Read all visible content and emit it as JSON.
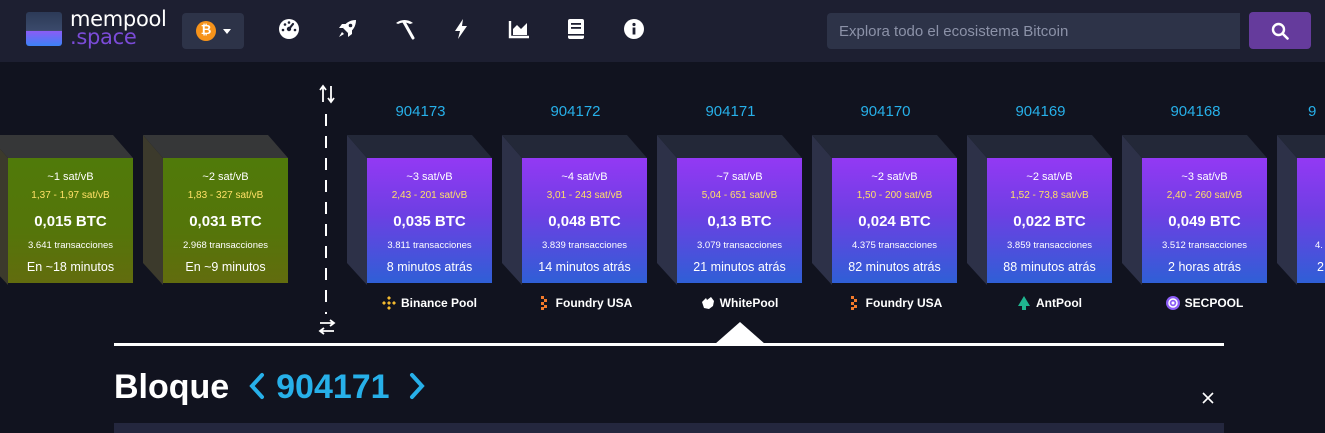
{
  "header": {
    "logo_line1": "mempool",
    "logo_line2": ".space",
    "network_symbol": "₿",
    "search_placeholder": "Explora todo el ecosistema Bitcoin",
    "nav_icons": [
      "dashboard-icon",
      "rocket-icon",
      "mining-icon",
      "lightning-icon",
      "graphs-icon",
      "docs-icon",
      "about-icon"
    ],
    "colors": {
      "bitcoin": "#f7931a",
      "accent": "#653b9c",
      "link": "#27b0e9"
    }
  },
  "pending_blocks": [
    {
      "fee": "~1 sat/vB",
      "range": "1,37 - 1,97 sat/vB",
      "size": "0,015 BTC",
      "tx": "3.641 transacciones",
      "time": "En ~18 minutos"
    },
    {
      "fee": "~2 sat/vB",
      "range": "1,83 - 327 sat/vB",
      "size": "0,031 BTC",
      "tx": "2.968 transacciones",
      "time": "En ~9 minutos"
    }
  ],
  "mined_blocks": [
    {
      "height": "904173",
      "fee": "~3 sat/vB",
      "range": "2,43 - 201 sat/vB",
      "size": "0,035 BTC",
      "tx": "3.811 transacciones",
      "time": "8 minutos atrás",
      "pool": "Binance Pool",
      "pool_icon": "binance-icon"
    },
    {
      "height": "904172",
      "fee": "~4 sat/vB",
      "range": "3,01 - 243 sat/vB",
      "size": "0,048 BTC",
      "tx": "3.839 transacciones",
      "time": "14 minutos atrás",
      "pool": "Foundry USA",
      "pool_icon": "foundry-icon"
    },
    {
      "height": "904171",
      "fee": "~7 sat/vB",
      "range": "5,04 - 651 sat/vB",
      "size": "0,13 BTC",
      "tx": "3.079 transacciones",
      "time": "21 minutos atrás",
      "pool": "WhitePool",
      "pool_icon": "whitepool-icon"
    },
    {
      "height": "904170",
      "fee": "~2 sat/vB",
      "range": "1,50 - 200 sat/vB",
      "size": "0,024 BTC",
      "tx": "4.375 transacciones",
      "time": "82 minutos atrás",
      "pool": "Foundry USA",
      "pool_icon": "foundry-icon"
    },
    {
      "height": "904169",
      "fee": "~2 sat/vB",
      "range": "1,52 - 73,8 sat/vB",
      "size": "0,022 BTC",
      "tx": "3.859 transacciones",
      "time": "88 minutos atrás",
      "pool": "AntPool",
      "pool_icon": "antpool-icon"
    },
    {
      "height": "904168",
      "fee": "~3 sat/vB",
      "range": "2,40 - 260 sat/vB",
      "size": "0,049 BTC",
      "tx": "3.512 transacciones",
      "time": "2 horas atrás",
      "pool": "SECPOOL",
      "pool_icon": "secpool-icon"
    }
  ],
  "partial_block": {
    "height": "9",
    "tx_fragment": "4.",
    "time_fragment": "2"
  },
  "block_detail": {
    "label": "Bloque",
    "height": "904171"
  }
}
